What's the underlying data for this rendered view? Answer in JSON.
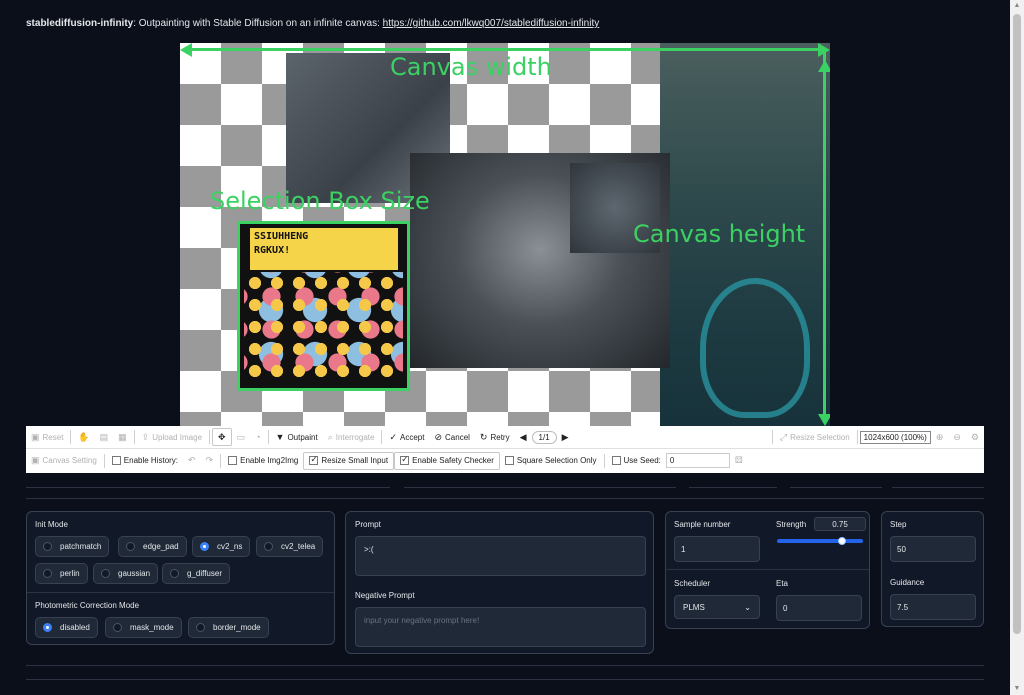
{
  "header": {
    "app_name": "stablediffusion-infinity",
    "description": ": Outpainting with Stable Diffusion on an infinite canvas: ",
    "link_text": "https://github.com/lkwq007/stablediffusion-infinity"
  },
  "annotations": {
    "canvas_width": "Canvas width",
    "canvas_height": "Canvas height",
    "selection_box": "Selection Box Size"
  },
  "selection_banner": [
    "SSIUHHENG",
    "RGKUX!"
  ],
  "toolbar": {
    "row1": {
      "reset": "Reset",
      "upload_image": "Upload Image",
      "outpaint": "Outpaint",
      "interrogate": "Interrogate",
      "accept": "Accept",
      "cancel": "Cancel",
      "retry": "Retry",
      "pager": "1/1",
      "resize_selection": "Resize Selection",
      "zoom_display": "1024x600 (100%)"
    },
    "row2": {
      "canvas_setting": "Canvas Setting",
      "enable_history": "Enable History:",
      "enable_img2img": "Enable Img2Img",
      "resize_small_input": "Resize Small Input",
      "enable_safety_checker": "Enable Safety Checker",
      "square_selection_only": "Square Selection Only",
      "use_seed": "Use Seed:",
      "seed_value": "0"
    }
  },
  "init_mode": {
    "label": "Init Mode",
    "options": [
      "patchmatch",
      "edge_pad",
      "cv2_ns",
      "cv2_telea",
      "perlin",
      "gaussian",
      "g_diffuser"
    ],
    "selected": "cv2_ns"
  },
  "photometric": {
    "label": "Photometric Correction Mode",
    "options": [
      "disabled",
      "mask_mode",
      "border_mode"
    ],
    "selected": "disabled"
  },
  "prompt": {
    "label": "Prompt",
    "value": ">:(",
    "negative_label": "Negative Prompt",
    "negative_placeholder": "input your negative prompt here!"
  },
  "params": {
    "sample_number_label": "Sample number",
    "sample_number": "1",
    "strength_label": "Strength",
    "strength": "0.75",
    "strength_fraction": 0.75,
    "scheduler_label": "Scheduler",
    "scheduler": "PLMS",
    "eta_label": "Eta",
    "eta": "0",
    "step_label": "Step",
    "step": "50",
    "guidance_label": "Guidance",
    "guidance": "7.5"
  },
  "colors": {
    "annotation": "#3bd163",
    "background": "#0b0f19",
    "accent": "#3b82f6"
  }
}
